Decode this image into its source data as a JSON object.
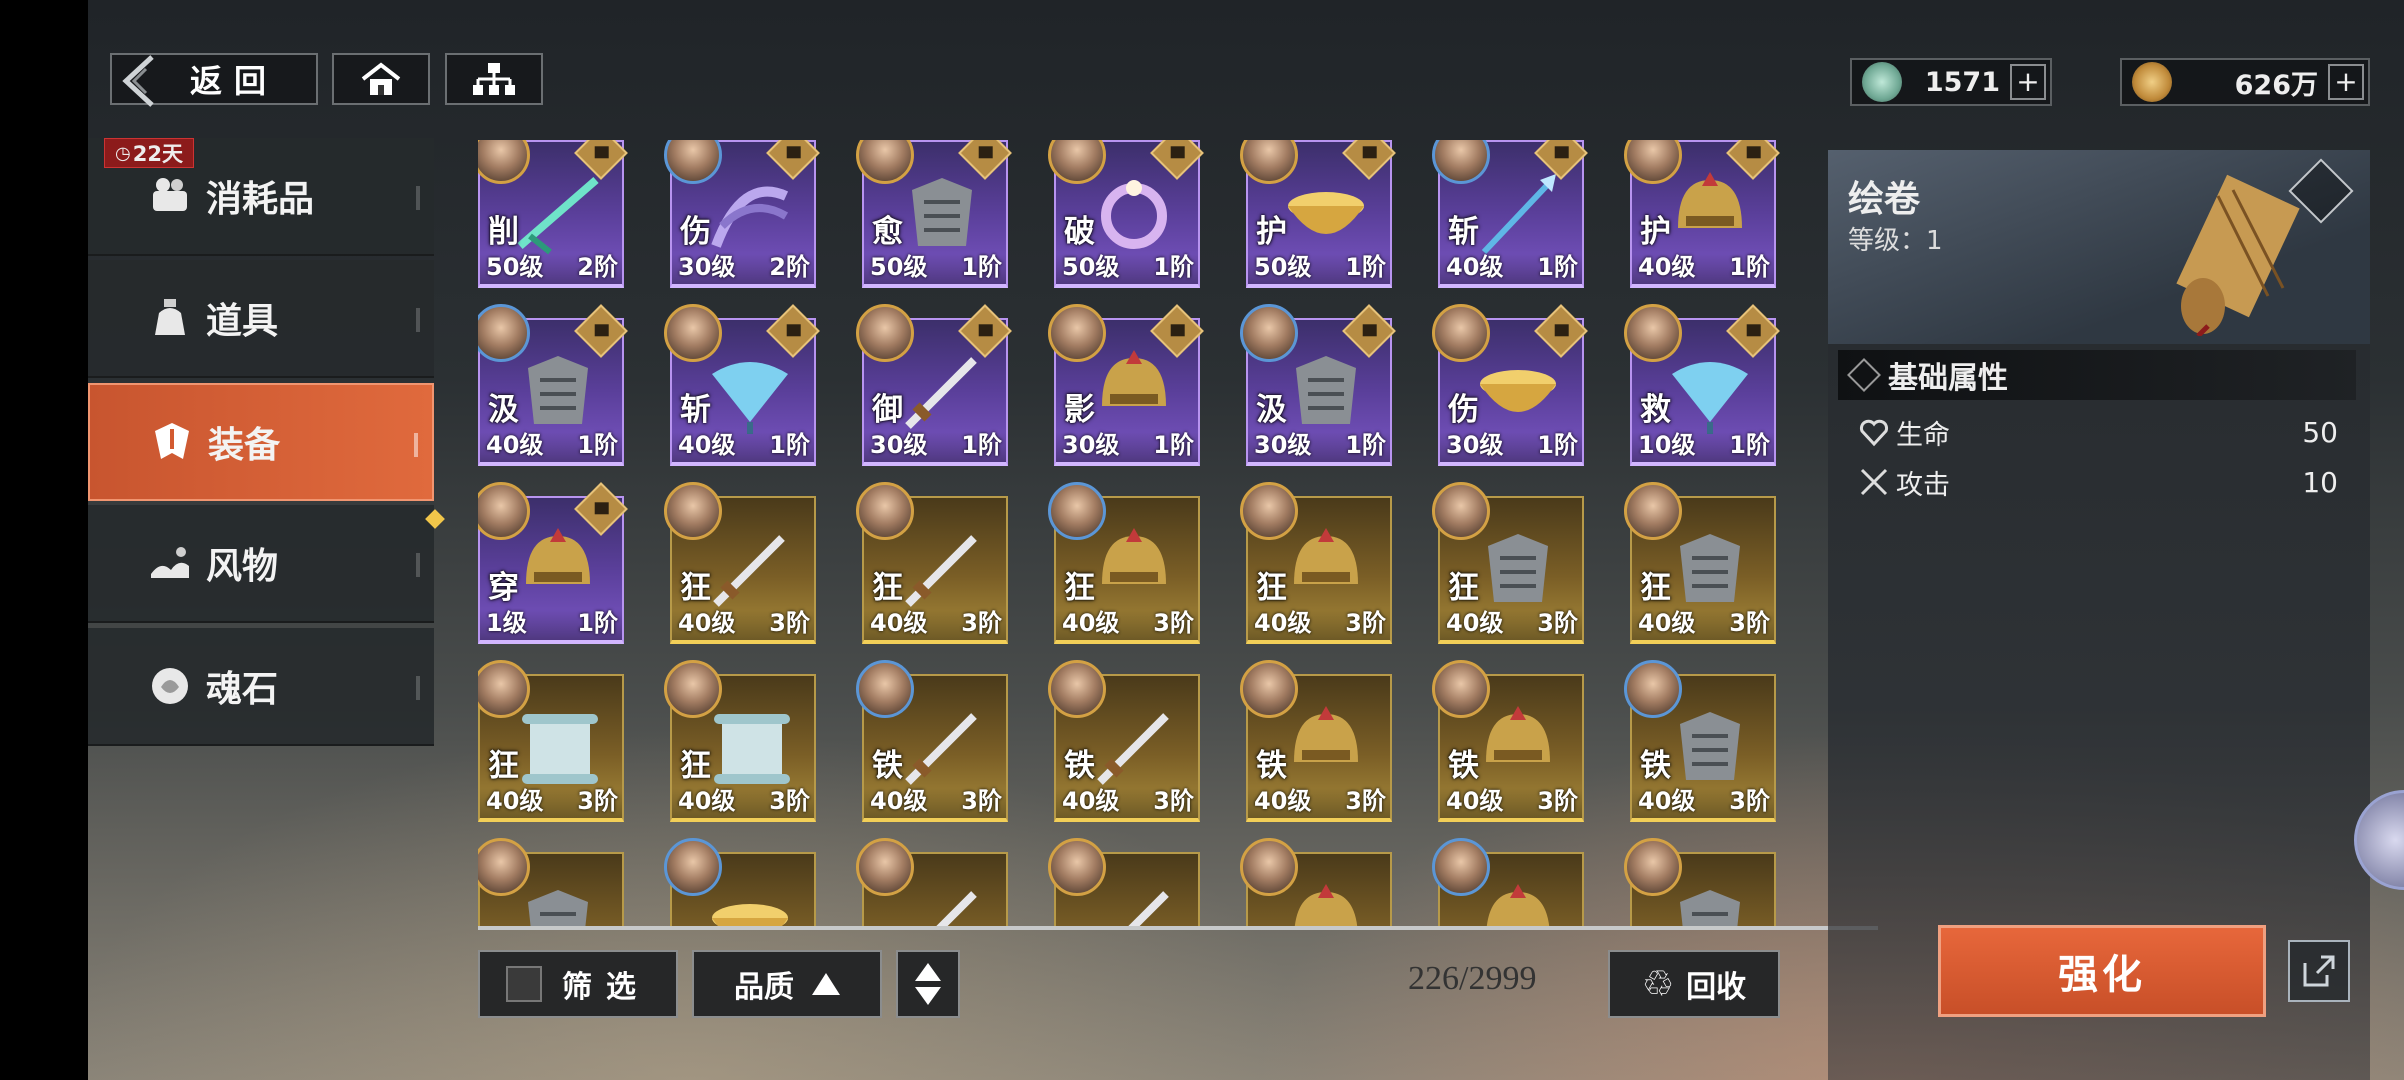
{
  "topbar": {
    "back_label": "返回",
    "currencies": [
      {
        "name": "jade",
        "value": "1571",
        "icon": "jade-coin-icon"
      },
      {
        "name": "coin",
        "value": "626万",
        "icon": "copper-coin-icon"
      }
    ]
  },
  "sidebar": {
    "timer_badge": "22天",
    "items": [
      {
        "label": "消耗品",
        "icon": "consumable-icon",
        "active": false
      },
      {
        "label": "道具",
        "icon": "item-bag-icon",
        "active": false
      },
      {
        "label": "装备",
        "icon": "equipment-icon",
        "active": true
      },
      {
        "label": "风物",
        "icon": "scenery-icon",
        "active": false
      },
      {
        "label": "魂石",
        "icon": "soul-stone-icon",
        "active": false
      }
    ]
  },
  "grid": {
    "rows": [
      [
        {
          "char": "削",
          "level": "50级",
          "tier": "2阶",
          "rarity": "purple",
          "locked": true,
          "art": "blade"
        },
        {
          "char": "伤",
          "level": "30级",
          "tier": "2阶",
          "rarity": "purple",
          "locked": true,
          "art": "claw"
        },
        {
          "char": "愈",
          "level": "50级",
          "tier": "1阶",
          "rarity": "purple",
          "locked": true,
          "art": "armor"
        },
        {
          "char": "破",
          "level": "50级",
          "tier": "1阶",
          "rarity": "purple",
          "locked": true,
          "art": "ring"
        },
        {
          "char": "护",
          "level": "50级",
          "tier": "1阶",
          "rarity": "purple",
          "locked": true,
          "art": "bowl"
        },
        {
          "char": "斩",
          "level": "40级",
          "tier": "1阶",
          "rarity": "purple",
          "locked": true,
          "art": "spear"
        },
        {
          "char": "护",
          "level": "40级",
          "tier": "1阶",
          "rarity": "purple",
          "locked": true,
          "art": "helmet"
        }
      ],
      [
        {
          "char": "汲",
          "level": "40级",
          "tier": "1阶",
          "rarity": "purple",
          "locked": true,
          "art": "armor"
        },
        {
          "char": "斩",
          "level": "40级",
          "tier": "1阶",
          "rarity": "purple",
          "locked": true,
          "art": "fan"
        },
        {
          "char": "御",
          "level": "30级",
          "tier": "1阶",
          "rarity": "purple",
          "locked": true,
          "art": "sword"
        },
        {
          "char": "影",
          "level": "30级",
          "tier": "1阶",
          "rarity": "purple",
          "locked": true,
          "art": "helmet"
        },
        {
          "char": "汲",
          "level": "30级",
          "tier": "1阶",
          "rarity": "purple",
          "locked": true,
          "art": "armor"
        },
        {
          "char": "伤",
          "level": "30级",
          "tier": "1阶",
          "rarity": "purple",
          "locked": true,
          "art": "bowl"
        },
        {
          "char": "救",
          "level": "10级",
          "tier": "1阶",
          "rarity": "purple",
          "locked": true,
          "art": "fan"
        }
      ],
      [
        {
          "char": "穿",
          "level": "1级",
          "tier": "1阶",
          "rarity": "purple",
          "locked": true,
          "art": "helmet"
        },
        {
          "char": "狂",
          "level": "40级",
          "tier": "3阶",
          "rarity": "gold",
          "locked": false,
          "art": "sword"
        },
        {
          "char": "狂",
          "level": "40级",
          "tier": "3阶",
          "rarity": "gold",
          "locked": false,
          "art": "sword"
        },
        {
          "char": "狂",
          "level": "40级",
          "tier": "3阶",
          "rarity": "gold",
          "locked": false,
          "art": "helmet"
        },
        {
          "char": "狂",
          "level": "40级",
          "tier": "3阶",
          "rarity": "gold",
          "locked": false,
          "art": "helmet"
        },
        {
          "char": "狂",
          "level": "40级",
          "tier": "3阶",
          "rarity": "gold",
          "locked": false,
          "art": "armor"
        },
        {
          "char": "狂",
          "level": "40级",
          "tier": "3阶",
          "rarity": "gold",
          "locked": false,
          "art": "armor"
        }
      ],
      [
        {
          "char": "狂",
          "level": "40级",
          "tier": "3阶",
          "rarity": "gold",
          "locked": false,
          "art": "scroll"
        },
        {
          "char": "狂",
          "level": "40级",
          "tier": "3阶",
          "rarity": "gold",
          "locked": false,
          "art": "scroll"
        },
        {
          "char": "铁",
          "level": "40级",
          "tier": "3阶",
          "rarity": "gold",
          "locked": false,
          "art": "sword"
        },
        {
          "char": "铁",
          "level": "40级",
          "tier": "3阶",
          "rarity": "gold",
          "locked": false,
          "art": "sword"
        },
        {
          "char": "铁",
          "level": "40级",
          "tier": "3阶",
          "rarity": "gold",
          "locked": false,
          "art": "helmet"
        },
        {
          "char": "铁",
          "level": "40级",
          "tier": "3阶",
          "rarity": "gold",
          "locked": false,
          "art": "helmet"
        },
        {
          "char": "铁",
          "level": "40级",
          "tier": "3阶",
          "rarity": "gold",
          "locked": false,
          "art": "armor"
        }
      ],
      [
        {
          "char": "",
          "level": "",
          "tier": "",
          "rarity": "gold",
          "locked": false,
          "art": "armor"
        },
        {
          "char": "",
          "level": "",
          "tier": "",
          "rarity": "gold",
          "locked": false,
          "art": "bowl"
        },
        {
          "char": "",
          "level": "",
          "tier": "",
          "rarity": "gold",
          "locked": false,
          "art": "sword"
        },
        {
          "char": "",
          "level": "",
          "tier": "",
          "rarity": "gold",
          "locked": false,
          "art": "sword"
        },
        {
          "char": "",
          "level": "",
          "tier": "",
          "rarity": "gold",
          "locked": false,
          "art": "helmet"
        },
        {
          "char": "",
          "level": "",
          "tier": "",
          "rarity": "gold",
          "locked": false,
          "art": "helmet"
        },
        {
          "char": "",
          "level": "",
          "tier": "",
          "rarity": "gold",
          "locked": false,
          "art": "armor"
        }
      ]
    ]
  },
  "controls": {
    "filter_label": "筛选",
    "quality_label": "品质",
    "count": "226/2999",
    "recycle_label": "回收"
  },
  "detail": {
    "title": "绘卷",
    "level_label": "等级：",
    "level_value": "1",
    "section_title": "基础属性",
    "attributes": [
      {
        "label": "生命",
        "value": "50",
        "icon": "heart-icon"
      },
      {
        "label": "攻击",
        "value": "10",
        "icon": "crossed-swords-icon"
      }
    ],
    "enhance_label": "强化"
  },
  "colors": {
    "accent": "#e06a3d",
    "purple_rarity": "#7a56c4",
    "gold_rarity": "#a88a3a"
  }
}
